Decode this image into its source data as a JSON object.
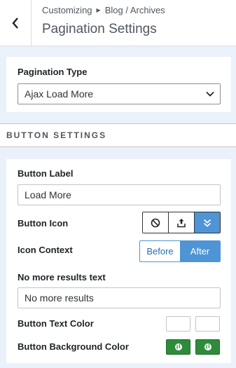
{
  "header": {
    "breadcrumb_root": "Customizing",
    "breadcrumb_section": "Blog / Archives",
    "title": "Pagination Settings"
  },
  "pagination": {
    "label": "Pagination Type",
    "value": "Ajax Load More"
  },
  "button_settings": {
    "heading": "BUTTON SETTINGS",
    "button_label_label": "Button Label",
    "button_label_value": "Load More",
    "button_icon_label": "Button Icon",
    "button_icon_options": [
      "ban-icon",
      "upload-icon",
      "double-chevron-down-icon"
    ],
    "button_icon_selected": "double-chevron-down-icon",
    "icon_context_label": "Icon Context",
    "icon_context_options": [
      "Before",
      "After"
    ],
    "icon_context_selected": "After",
    "no_more_label": "No more results text",
    "no_more_value": "No more results",
    "text_color_label": "Button Text Color",
    "bg_color_label": "Button Background Color"
  },
  "colors": {
    "accent": "#4f94d4",
    "swatch_bg": "#2e8b3a"
  }
}
